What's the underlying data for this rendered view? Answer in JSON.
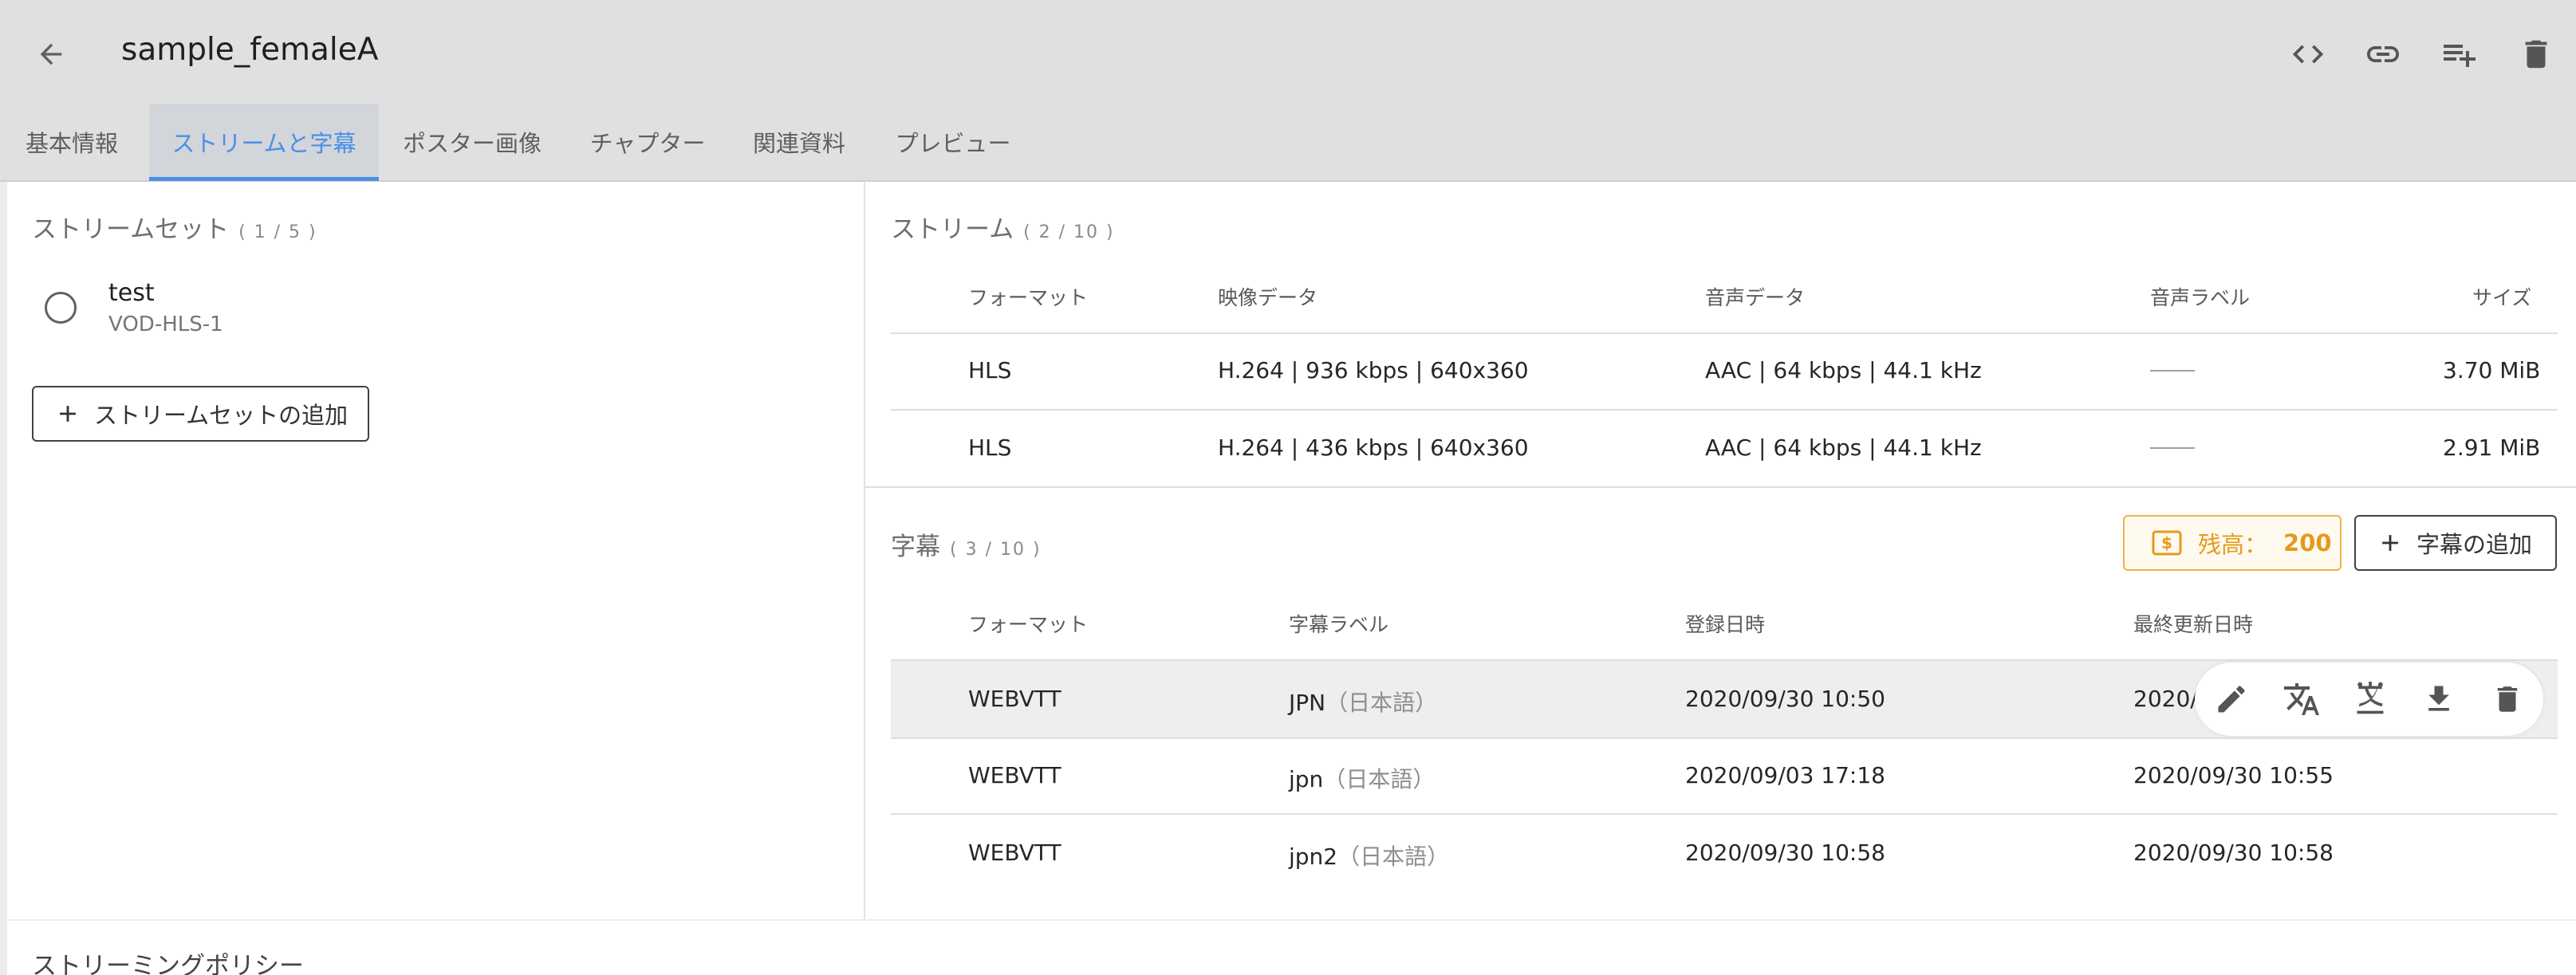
{
  "header": {
    "title": "sample_femaleA",
    "tabs": [
      {
        "label": "基本情報"
      },
      {
        "label": "ストリームと字幕"
      },
      {
        "label": "ポスター画像"
      },
      {
        "label": "チャプター"
      },
      {
        "label": "関連資料"
      },
      {
        "label": "プレビュー"
      }
    ],
    "active_tab": 1,
    "actions": [
      "code-icon",
      "link-icon",
      "playlist-add-icon",
      "delete-icon"
    ]
  },
  "stream_sets": {
    "title": "ストリームセット",
    "count": "( 1 / 5 )",
    "items": [
      {
        "name": "test",
        "subtitle": "VOD-HLS-1"
      }
    ],
    "add_label": "ストリームセットの追加"
  },
  "streams": {
    "title": "ストリーム",
    "count": "( 2 / 10 )",
    "headers": {
      "format": "フォーマット",
      "video": "映像データ",
      "audio": "音声データ",
      "audio_label": "音声ラベル",
      "size": "サイズ"
    },
    "rows": [
      {
        "format": "HLS",
        "video": "H.264 | 936 kbps | 640x360",
        "audio": "AAC | 64 kbps | 44.1 kHz",
        "audio_label": "——",
        "size": "3.70 MiB"
      },
      {
        "format": "HLS",
        "video": "H.264 | 436 kbps | 640x360",
        "audio": "AAC | 64 kbps | 44.1 kHz",
        "audio_label": "——",
        "size": "2.91 MiB"
      }
    ]
  },
  "subtitles": {
    "title": "字幕",
    "count": "( 3 / 10 )",
    "balance_label": "残高：",
    "balance_value": "200",
    "add_label": "字幕の追加",
    "headers": {
      "format": "フォーマット",
      "label": "字幕ラベル",
      "created": "登録日時",
      "updated": "最終更新日時"
    },
    "rows": [
      {
        "format": "WEBVTT",
        "label": "JPN",
        "lang": "（日本語）",
        "created": "2020/09/30 10:50",
        "updated": "2020/"
      },
      {
        "format": "WEBVTT",
        "label": "jpn",
        "lang": "（日本語）",
        "created": "2020/09/03 17:18",
        "updated": "2020/09/30 10:55"
      },
      {
        "format": "WEBVTT",
        "label": "jpn2",
        "lang": "（日本語）",
        "created": "2020/09/30 10:58",
        "updated": "2020/09/30 10:58"
      }
    ],
    "row_actions": [
      "edit-icon",
      "translate-icon",
      "transcribe-icon",
      "download-icon",
      "delete-icon"
    ]
  },
  "streaming_policy": {
    "title": "ストリーミングポリシー"
  },
  "colors": {
    "accent": "#4b8fe8",
    "header_bg": "#e0e0e0",
    "balance": "#e59a1c"
  }
}
